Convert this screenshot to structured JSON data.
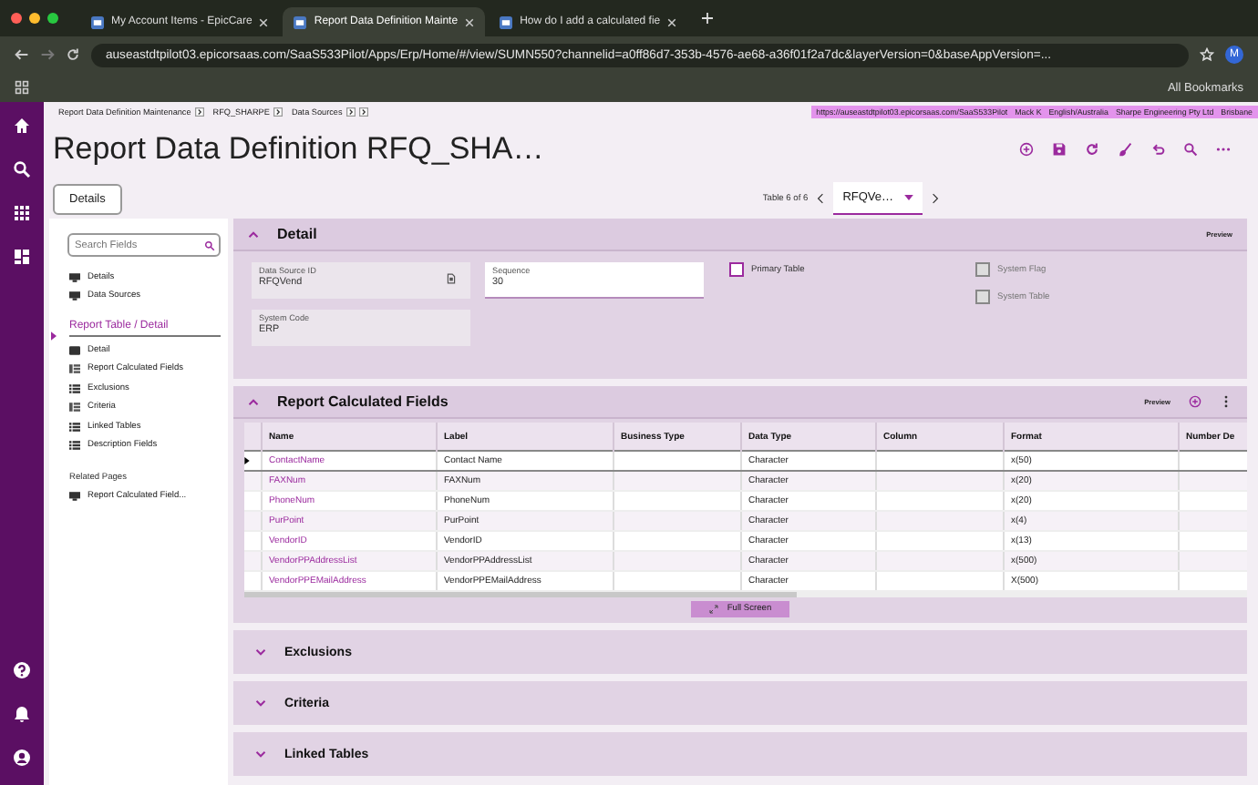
{
  "browser": {
    "tabs": [
      {
        "title": "My Account Items - EpicCare",
        "selected": false
      },
      {
        "title": "Report Data Definition Mainte",
        "selected": true
      },
      {
        "title": "How do I add a calculated fie",
        "selected": false
      }
    ],
    "url": "auseastdtpilot03.epicorsaas.com/SaaS533Pilot/Apps/Erp/Home/#/view/SUMN550?channelid=a0ff86d7-353b-4576-ae68-a36f01f2a7dc&layerVersion=0&baseAppVersion=...",
    "profile": "M",
    "bookmarks": "All Bookmarks"
  },
  "breadcrumbs": [
    "Report Data Definition Maintenance",
    "RFQ_SHARPE",
    "Data Sources"
  ],
  "info": [
    "https://auseastdtpilot03.epicorsaas.com/SaaS533Pilot",
    "Mack K",
    "English/Australia",
    "Sharpe Engineering Pty Ltd",
    "Brisbane"
  ],
  "title": "Report Data Definition RFQ_SHA…",
  "details_button": "Details",
  "pager": {
    "label": "Table 6 of 6",
    "value": "RFQVe…"
  },
  "nav": {
    "search": {
      "placeholder": "Search Fields"
    },
    "items": [
      {
        "label": "Details",
        "kind": "page"
      },
      {
        "label": "Data Sources",
        "kind": "page"
      },
      {
        "label": "Report Table / Detail",
        "kind": "group",
        "selected": true,
        "children": [
          {
            "label": "Detail",
            "kind": "form"
          },
          {
            "label": "Report Calculated Fields",
            "kind": "grid"
          },
          {
            "label": "Exclusions",
            "kind": "list"
          },
          {
            "label": "Criteria",
            "kind": "grid"
          },
          {
            "label": "Linked Tables",
            "kind": "list"
          },
          {
            "label": "Description Fields",
            "kind": "list"
          }
        ]
      }
    ],
    "related_title": "Related Pages",
    "related": [
      {
        "label": "Report Calculated Field..."
      }
    ]
  },
  "detail": {
    "title": "Detail",
    "preview": "Preview",
    "fields": [
      {
        "label": "Data Source ID",
        "value": "RFQVend",
        "readonly": true
      },
      {
        "label": "Sequence",
        "value": "30",
        "readonly": false
      },
      {
        "label": "System Code",
        "value": "ERP",
        "readonly": true
      }
    ],
    "checkboxes": [
      {
        "label": "Primary Table",
        "checked": false,
        "disabled": false
      },
      {
        "label": "System Flag",
        "checked": false,
        "disabled": true
      },
      {
        "label": "System Table",
        "checked": false,
        "disabled": true
      }
    ]
  },
  "calc": {
    "title": "Report Calculated Fields",
    "preview": "Preview",
    "columns": [
      "Name",
      "Label",
      "Business Type",
      "Data Type",
      "Column",
      "Format",
      "Number De"
    ],
    "rows": [
      {
        "selected": true,
        "cells": [
          "ContactName",
          "Contact Name",
          "",
          "Character",
          "",
          "x(50)",
          ""
        ]
      },
      {
        "selected": false,
        "cells": [
          "FAXNum",
          "FAXNum",
          "",
          "Character",
          "",
          "x(20)",
          ""
        ]
      },
      {
        "selected": false,
        "cells": [
          "PhoneNum",
          "PhoneNum",
          "",
          "Character",
          "",
          "x(20)",
          ""
        ]
      },
      {
        "selected": false,
        "cells": [
          "PurPoint",
          "PurPoint",
          "",
          "Character",
          "",
          "x(4)",
          ""
        ]
      },
      {
        "selected": false,
        "cells": [
          "VendorID",
          "VendorID",
          "",
          "Character",
          "",
          "x(13)",
          ""
        ]
      },
      {
        "selected": false,
        "cells": [
          "VendorPPAddressList",
          "VendorPPAddressList",
          "",
          "Character",
          "",
          "x(500)",
          ""
        ]
      },
      {
        "selected": false,
        "cells": [
          "VendorPPEMailAddress",
          "VendorPPEMailAddress",
          "",
          "Character",
          "",
          "X(500)",
          ""
        ]
      }
    ],
    "full_screen": "Full Screen"
  },
  "sections": [
    {
      "title": "Exclusions",
      "expanded": false
    },
    {
      "title": "Criteria",
      "expanded": false
    },
    {
      "title": "Linked Tables",
      "expanded": false
    }
  ]
}
